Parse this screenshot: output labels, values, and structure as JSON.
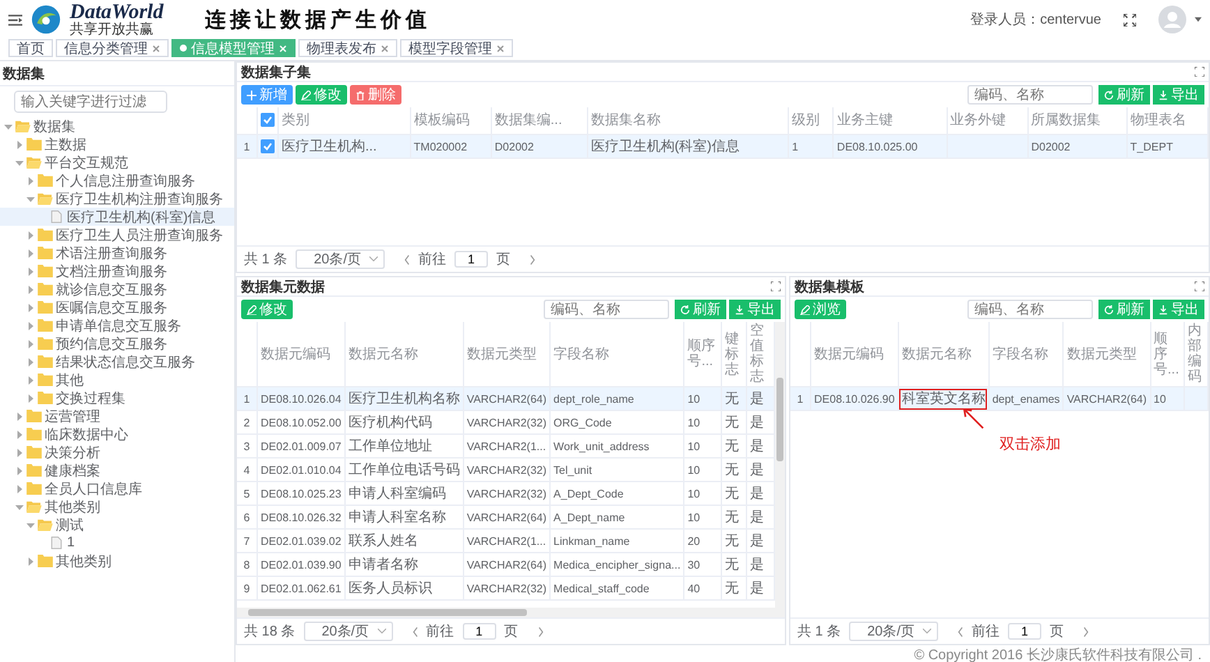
{
  "header": {
    "brand": "DataWorld",
    "brand_subtitle": "共享开放共赢",
    "slogan": "连接让数据产生价值",
    "user_label": "登录人员：centervue"
  },
  "tabs": [
    {
      "label": "首页",
      "selected": false,
      "closable": false
    },
    {
      "label": "信息分类管理",
      "selected": false,
      "closable": true
    },
    {
      "label": "信息模型管理",
      "selected": true,
      "closable": true
    },
    {
      "label": "物理表发布",
      "selected": false,
      "closable": true
    },
    {
      "label": "模型字段管理",
      "selected": false,
      "closable": true
    }
  ],
  "sidebar": {
    "title": "数据集",
    "filter_placeholder": "输入关键字进行过滤",
    "tree": [
      {
        "label": "数据集",
        "kind": "folder",
        "expanded": true,
        "selected": false,
        "children": [
          {
            "label": "主数据",
            "kind": "folder",
            "expanded": false,
            "selected": false
          },
          {
            "label": "平台交互规范",
            "kind": "folder",
            "expanded": true,
            "selected": false,
            "children": [
              {
                "label": "个人信息注册查询服务",
                "kind": "folder",
                "expanded": false,
                "selected": false
              },
              {
                "label": "医疗卫生机构注册查询服务",
                "kind": "folder",
                "expanded": true,
                "selected": false,
                "children": [
                  {
                    "label": "医疗卫生机构(科室)信息",
                    "kind": "file",
                    "selected": true
                  }
                ]
              },
              {
                "label": "医疗卫生人员注册查询服务",
                "kind": "folder",
                "expanded": false,
                "selected": false
              },
              {
                "label": "术语注册查询服务",
                "kind": "folder",
                "expanded": false,
                "selected": false
              },
              {
                "label": "文档注册查询服务",
                "kind": "folder",
                "expanded": false,
                "selected": false
              },
              {
                "label": "就诊信息交互服务",
                "kind": "folder",
                "expanded": false,
                "selected": false
              },
              {
                "label": "医嘱信息交互服务",
                "kind": "folder",
                "expanded": false,
                "selected": false
              },
              {
                "label": "申请单信息交互服务",
                "kind": "folder",
                "expanded": false,
                "selected": false
              },
              {
                "label": "预约信息交互服务",
                "kind": "folder",
                "expanded": false,
                "selected": false
              },
              {
                "label": "结果状态信息交互服务",
                "kind": "folder",
                "expanded": false,
                "selected": false
              },
              {
                "label": "其他",
                "kind": "folder",
                "expanded": false,
                "selected": false
              },
              {
                "label": "交换过程集",
                "kind": "folder",
                "expanded": false,
                "selected": false
              }
            ]
          },
          {
            "label": "运营管理",
            "kind": "folder",
            "expanded": false,
            "selected": false
          },
          {
            "label": "临床数据中心",
            "kind": "folder",
            "expanded": false,
            "selected": false
          },
          {
            "label": "决策分析",
            "kind": "folder",
            "expanded": false,
            "selected": false
          },
          {
            "label": "健康档案",
            "kind": "folder",
            "expanded": false,
            "selected": false
          },
          {
            "label": "全员人口信息库",
            "kind": "folder",
            "expanded": false,
            "selected": false
          },
          {
            "label": "其他类别",
            "kind": "folder",
            "expanded": true,
            "selected": false,
            "children": [
              {
                "label": "测试",
                "kind": "folder",
                "expanded": true,
                "selected": false,
                "children": [
                  {
                    "label": "1",
                    "kind": "file",
                    "selected": false
                  }
                ]
              },
              {
                "label": "其他类别",
                "kind": "folder",
                "expanded": false,
                "selected": false
              }
            ]
          }
        ]
      }
    ]
  },
  "panels": [
    {
      "title": "数据集子集",
      "buttons": [
        {
          "kind": "add",
          "label": "新增"
        },
        {
          "kind": "edit",
          "label": "修改"
        },
        {
          "kind": "delete",
          "label": "删除"
        }
      ],
      "search_placeholder": "编码、名称",
      "actions": [
        {
          "kind": "refresh",
          "label": "刷新"
        },
        {
          "kind": "export",
          "label": "导出"
        }
      ],
      "header_checked": true,
      "columns": [
        "类别",
        "模板编码",
        "数据集编...",
        "数据集名称",
        "级别",
        "业务主键",
        "业务外键",
        "所属数据集",
        "物理表名"
      ],
      "rows": [
        {
          "index": "1",
          "selected": true,
          "checked": true,
          "cells": [
            "医疗卫生机构...",
            "TM020002",
            "D02002",
            "医疗卫生机构(科室)信息",
            "1",
            "DE08.10.025.00",
            null,
            "D02002",
            "T_DEPT"
          ]
        }
      ],
      "pagination": {
        "total": "共 1 条",
        "page_size": "20条/页",
        "goto": "前往",
        "page": "1",
        "page_suffix": "页"
      }
    },
    {
      "title": "数据集元数据",
      "buttons": [
        {
          "kind": "edit",
          "label": "修改"
        }
      ],
      "search_placeholder": "编码、名称",
      "actions": [
        {
          "kind": "refresh",
          "label": "刷新"
        },
        {
          "kind": "export",
          "label": "导出"
        }
      ],
      "scrollbars": true,
      "columns": [
        "数据元编码",
        "数据元名称",
        "数据元类型",
        "字段名称",
        "顺序号...",
        "键标志",
        "空值标志"
      ],
      "rows": [
        {
          "index": "1",
          "selected": true,
          "cells": [
            "DE08.10.026.04",
            "医疗卫生机构名称",
            "VARCHAR2(64)",
            "dept_role_name",
            "10",
            "无",
            "是"
          ]
        },
        {
          "index": "2",
          "selected": false,
          "cells": [
            "DE08.10.052.00",
            "医疗机构代码",
            "VARCHAR2(32)",
            "ORG_Code",
            "10",
            "无",
            "是"
          ]
        },
        {
          "index": "3",
          "selected": false,
          "cells": [
            "DE02.01.009.07",
            "工作单位地址",
            "VARCHAR2(1...",
            "Work_unit_address",
            "10",
            "无",
            "是"
          ]
        },
        {
          "index": "4",
          "selected": false,
          "cells": [
            "DE02.01.010.04",
            "工作单位电话号码",
            "VARCHAR2(32)",
            "Tel_unit",
            "10",
            "无",
            "是"
          ]
        },
        {
          "index": "5",
          "selected": false,
          "cells": [
            "DE08.10.025.23",
            "申请人科室编码",
            "VARCHAR2(32)",
            "A_Dept_Code",
            "10",
            "无",
            "是"
          ]
        },
        {
          "index": "6",
          "selected": false,
          "cells": [
            "DE08.10.026.32",
            "申请人科室名称",
            "VARCHAR2(64)",
            "A_Dept_name",
            "10",
            "无",
            "是"
          ]
        },
        {
          "index": "7",
          "selected": false,
          "cells": [
            "DE02.01.039.02",
            "联系人姓名",
            "VARCHAR2(1...",
            "Linkman_name",
            "20",
            "无",
            "是"
          ]
        },
        {
          "index": "8",
          "selected": false,
          "cells": [
            "DE02.01.039.90",
            "申请者名称",
            "VARCHAR2(64)",
            "Medica_encipher_signa...",
            "30",
            "无",
            "是"
          ]
        },
        {
          "index": "9",
          "selected": false,
          "cells": [
            "DE02.01.062.61",
            "医务人员标识",
            "VARCHAR2(32)",
            "Medical_staff_code",
            "40",
            "无",
            "是"
          ]
        }
      ],
      "pagination": {
        "total": "共 18 条",
        "page_size": "20条/页",
        "goto": "前往",
        "page": "1",
        "page_suffix": "页"
      }
    },
    {
      "title": "数据集模板",
      "buttons": [
        {
          "kind": "view",
          "label": "浏览"
        }
      ],
      "search_placeholder": "编码、名称",
      "actions": [
        {
          "kind": "refresh",
          "label": "刷新"
        },
        {
          "kind": "export",
          "label": "导出"
        }
      ],
      "columns": [
        "数据元编码",
        "数据元名称",
        "字段名称",
        "数据元类型",
        "顺序号...",
        "内部编码"
      ],
      "rows": [
        {
          "index": "1",
          "selected": true,
          "outlined_cells": [
            false,
            true,
            false,
            false,
            false,
            false
          ],
          "cells": [
            "DE08.10.026.90",
            "科室英文名称",
            "dept_enames",
            "VARCHAR2(64)",
            "10",
            null
          ]
        }
      ],
      "callout": "双击添加",
      "pagination": {
        "total": "共 1 条",
        "page_size": "20条/页",
        "goto": "前往",
        "page": "1",
        "page_suffix": "页"
      }
    }
  ],
  "footer": "© Copyright 2016 长沙康氏软件科技有限公司 ."
}
